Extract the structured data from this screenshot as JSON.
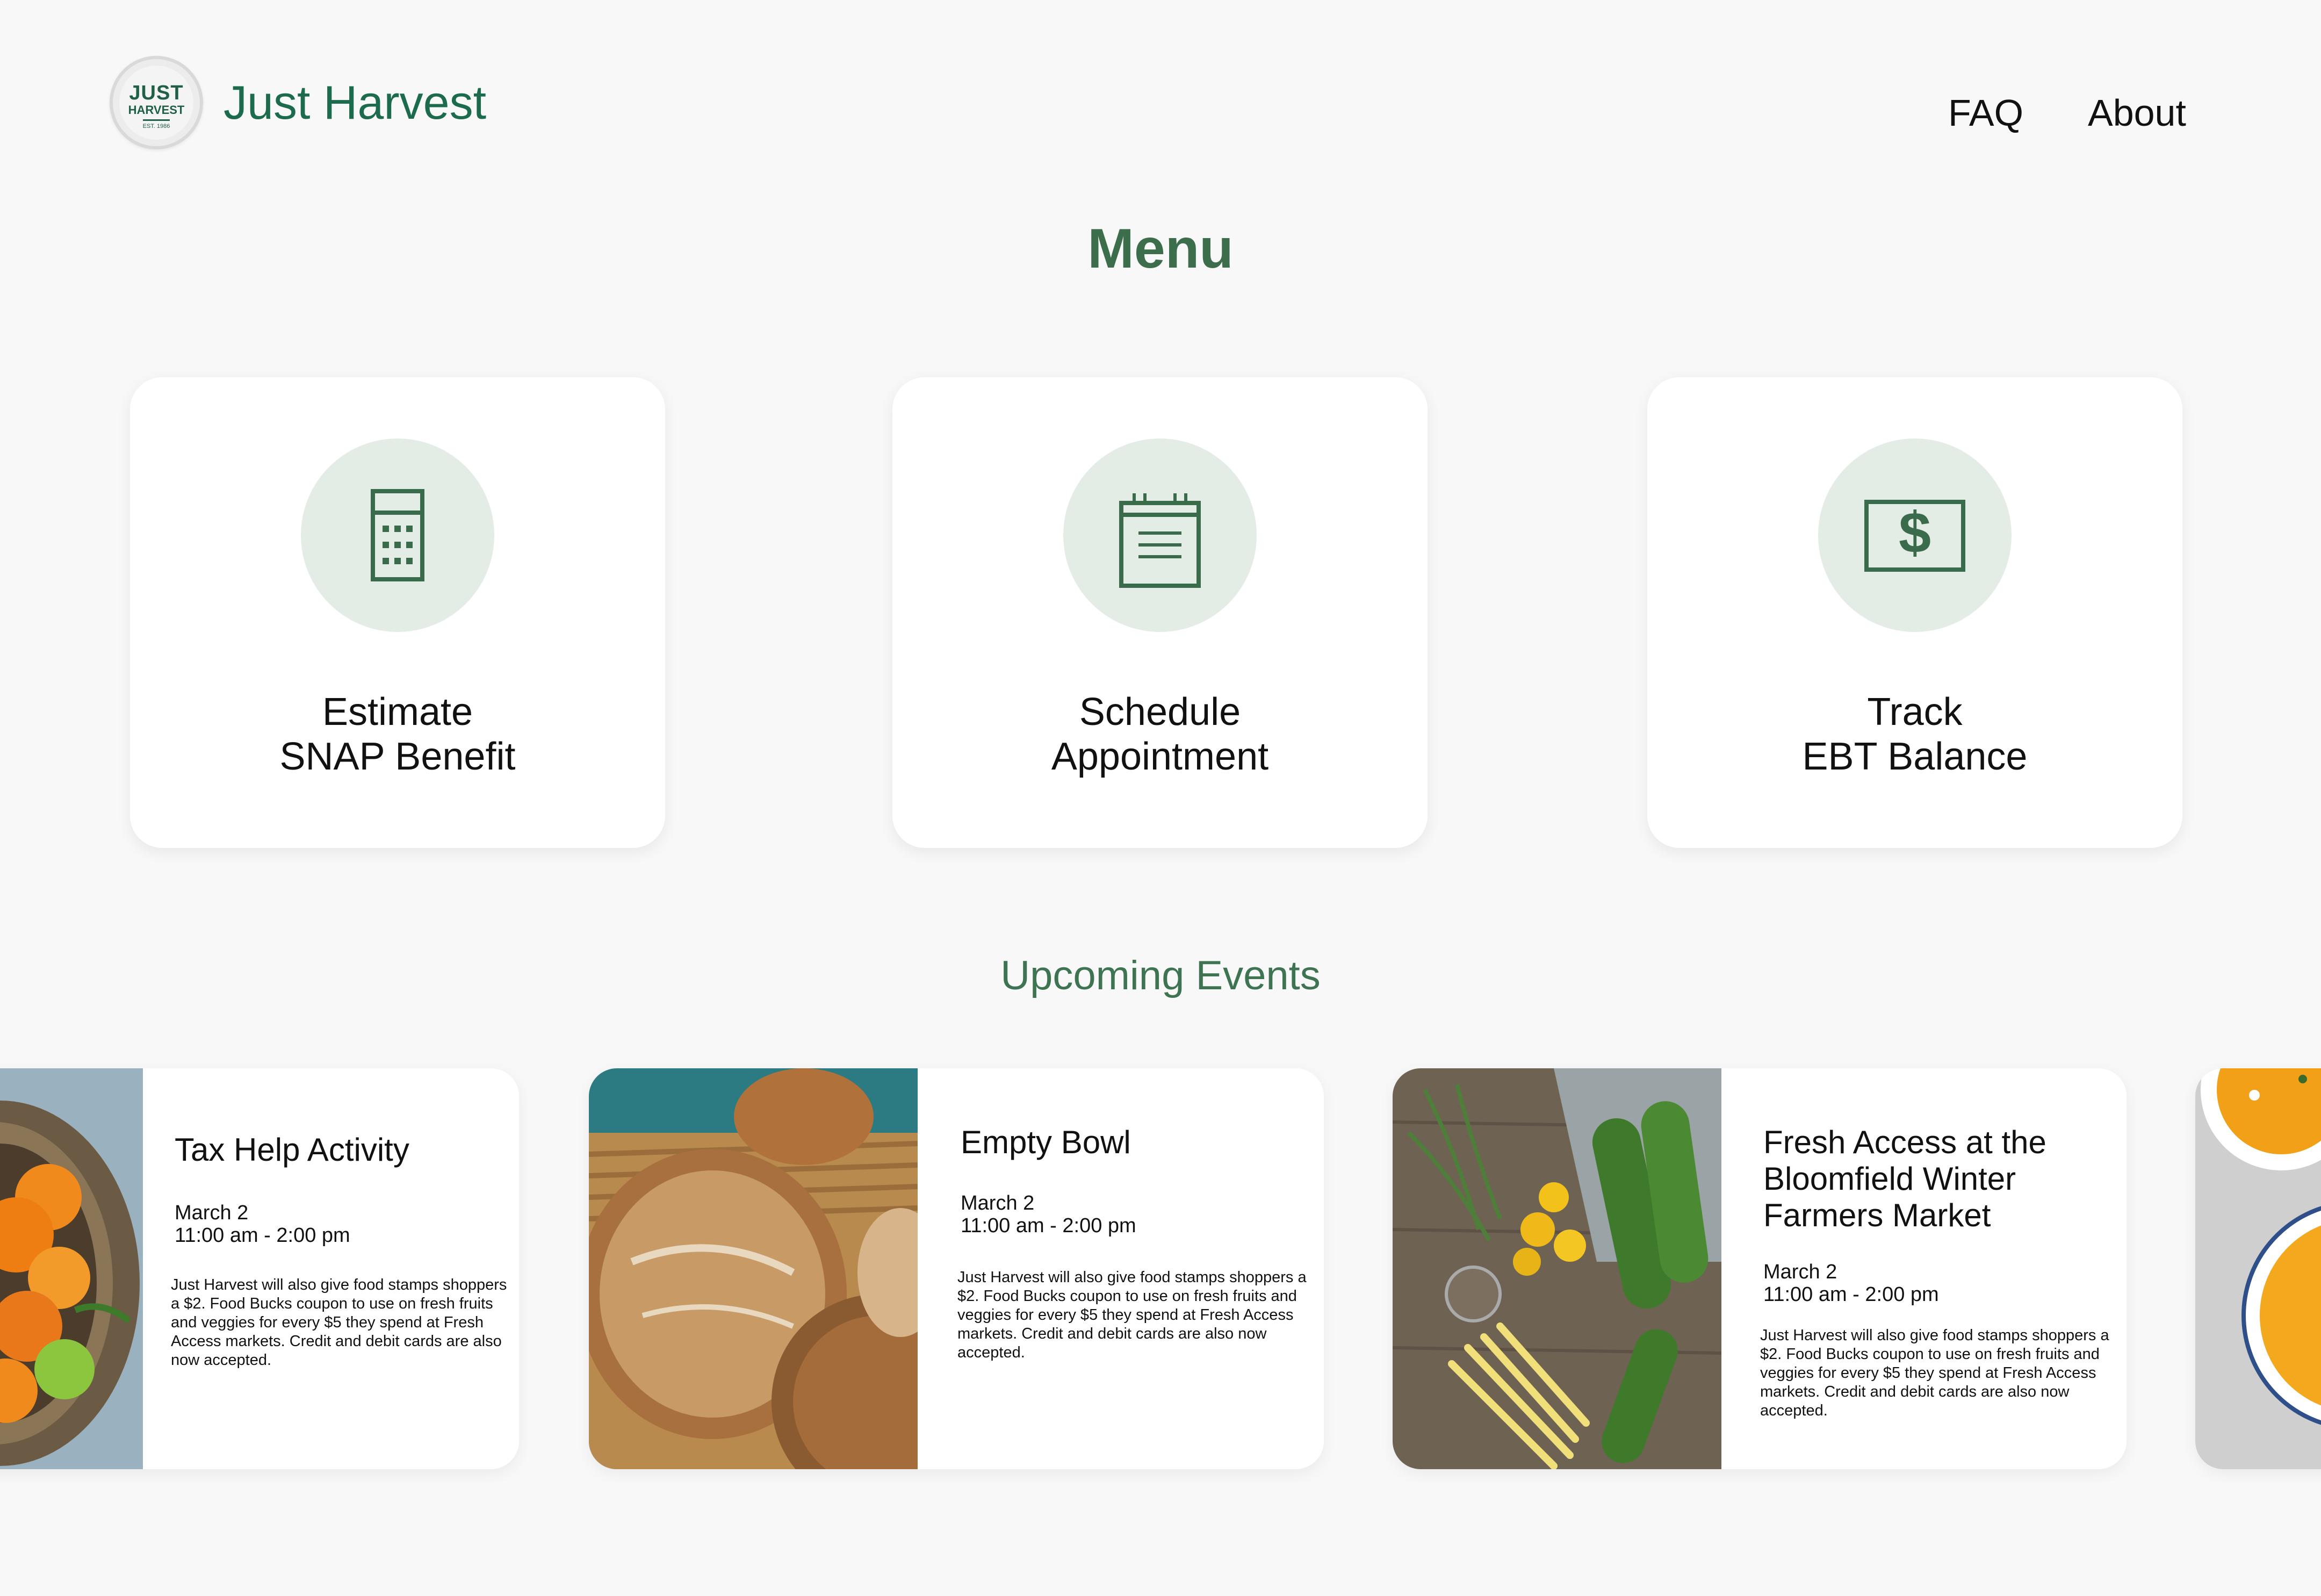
{
  "header": {
    "logo": {
      "line1": "JUST",
      "line2": "HARVEST",
      "line3": "EST. 1986"
    },
    "brand": "Just Harvest",
    "nav": [
      {
        "label": "FAQ"
      },
      {
        "label": "About"
      }
    ]
  },
  "menu": {
    "title": "Menu",
    "cards": [
      {
        "line1": "Estimate",
        "line2": "SNAP Benefit",
        "icon": "calculator-icon"
      },
      {
        "line1": "Schedule",
        "line2": "Appointment",
        "icon": "calendar-icon"
      },
      {
        "line1": "Track",
        "line2": "EBT Balance",
        "icon": "dollar-bill-icon"
      }
    ]
  },
  "events": {
    "title": "Upcoming Events",
    "items": [
      {
        "title": "Tax Help Activity",
        "date": "March 2",
        "time": "11:00 am - 2:00 pm",
        "description": "Just Harvest will also give food stamps shoppers a $2. Food Bucks coupon to use on fresh fruits and veggies for every $5 they spend at Fresh Access markets. Credit and debit cards are also now accepted.",
        "image": "fruit-basket-photo"
      },
      {
        "title": "Empty Bowl",
        "date": "March 2",
        "time": "11:00 am - 2:00 pm",
        "description": "Just Harvest will also give food stamps shoppers a $2. Food Bucks coupon to use on fresh fruits and veggies for every $5 they spend at Fresh Access markets. Credit and debit cards are also now accepted.",
        "image": "bread-loaves-photo"
      },
      {
        "title": "Fresh Access at the Bloomfield Winter Farmers Market",
        "date": "March 2",
        "time": "11:00 am - 2:00 pm",
        "description": "Just Harvest will also give food stamps shoppers a $2. Food Bucks coupon to use on fresh fruits and veggies for every $5 they spend at Fresh Access markets. Credit and debit cards are also now accepted.",
        "image": "vegetables-photo"
      },
      {
        "image": "soup-bowls-photo"
      }
    ]
  },
  "colors": {
    "brand_green": "#1b6b4c",
    "heading_green": "#3d6e4c",
    "icon_green": "#3a6b4b",
    "icon_circle": "#e4ece6",
    "background": "#f8f8f8",
    "card": "#ffffff"
  }
}
